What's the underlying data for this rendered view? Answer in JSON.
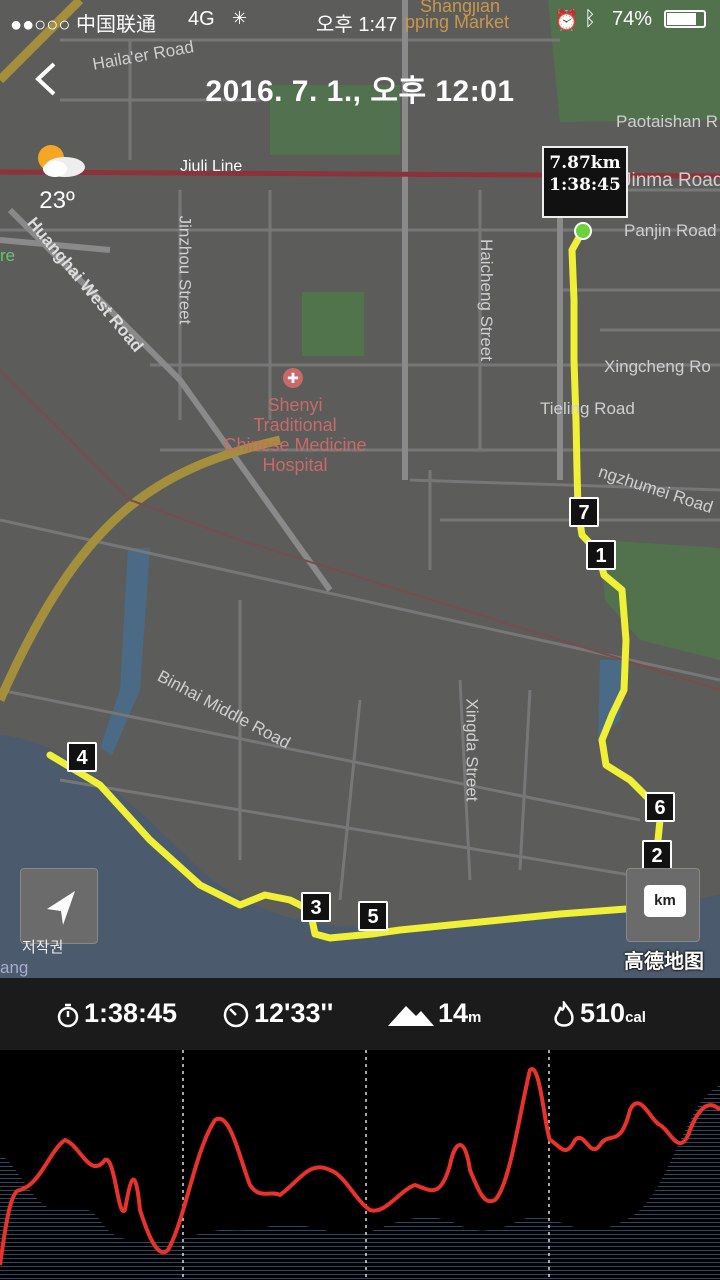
{
  "status_bar": {
    "carrier": "●●○○○ 中国联通",
    "network": "4G",
    "time": "오후 1:47",
    "battery": "74%"
  },
  "header": {
    "title": "2016. 7. 1., 오후 12:01"
  },
  "weather": {
    "icon": "partly-cloudy-icon",
    "temperature": "23º"
  },
  "map": {
    "labels": {
      "shangjian": "Shangjian",
      "shopping": "pping Market",
      "haila": "Haila'er Road",
      "jiuli": "Jiuli Line",
      "paotaishan": "Paotaishan R",
      "jinma": "Jinma Road",
      "panjin": "Panjin Road",
      "huanghai": "Huanghai West Road",
      "jinzhou": "Jinzhou Street",
      "haicheng": "Haicheng Street",
      "xingcheng": "Xingcheng Ro",
      "tieling": "Tieling Road",
      "zhumei": "ngzhumei Road",
      "binhai": "Binhai Middle Road",
      "xingda": "Xingda Street",
      "re": "re",
      "ang": "ang"
    },
    "hospital": {
      "line1": "Shenyi",
      "line2": "Traditional",
      "line3": "Chinese Medicine",
      "line4": "Hospital"
    },
    "callout": {
      "distance": "7.87km",
      "duration": "1:38:45"
    },
    "markers": [
      "1",
      "2",
      "3",
      "4",
      "5",
      "6",
      "7"
    ],
    "unit_button": "km",
    "copyright": "저작권",
    "provider": "高德地图",
    "route_color": "#f5f531"
  },
  "stats": {
    "duration": "1:38:45",
    "pace": "12'33''",
    "elevation": "14",
    "elevation_unit": "m",
    "calories": "510",
    "calories_unit": "cal"
  }
}
